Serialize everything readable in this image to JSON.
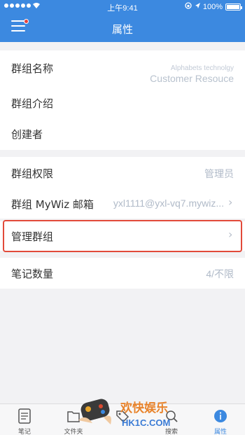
{
  "status_bar": {
    "time": "上午9:41",
    "battery": "100%",
    "battery_level": 1.0
  },
  "nav": {
    "title": "属性"
  },
  "info_group": [
    {
      "label": "群组名称"
    },
    {
      "label": "群组介绍"
    },
    {
      "label": "创建者"
    }
  ],
  "ad": {
    "small": "Alphabets technolgy",
    "big": "Customer Resouce"
  },
  "permission_group": {
    "permission": {
      "label": "群组权限",
      "value": "管理员"
    },
    "email": {
      "label": "群组 MyWiz 邮箱",
      "value": "yxl1111@yxl-vq7.mywiz..."
    }
  },
  "manage": {
    "label": "管理群组"
  },
  "notes": {
    "label": "笔记数量",
    "value": "4/不限"
  },
  "tabs": [
    {
      "label": "笔记",
      "icon": "note-icon"
    },
    {
      "label": "文件夹",
      "icon": "folder-icon"
    },
    {
      "label": "",
      "icon": "tag-icon"
    },
    {
      "label": "搜索",
      "icon": "search-icon"
    },
    {
      "label": "属性",
      "icon": "info-icon",
      "active": true
    }
  ],
  "watermark": {
    "title": "欢快娱乐",
    "domain": "HK1C.COM"
  },
  "colors": {
    "accent": "#3c89e0",
    "highlight": "#e24a3a",
    "value": "#b0bac8"
  }
}
